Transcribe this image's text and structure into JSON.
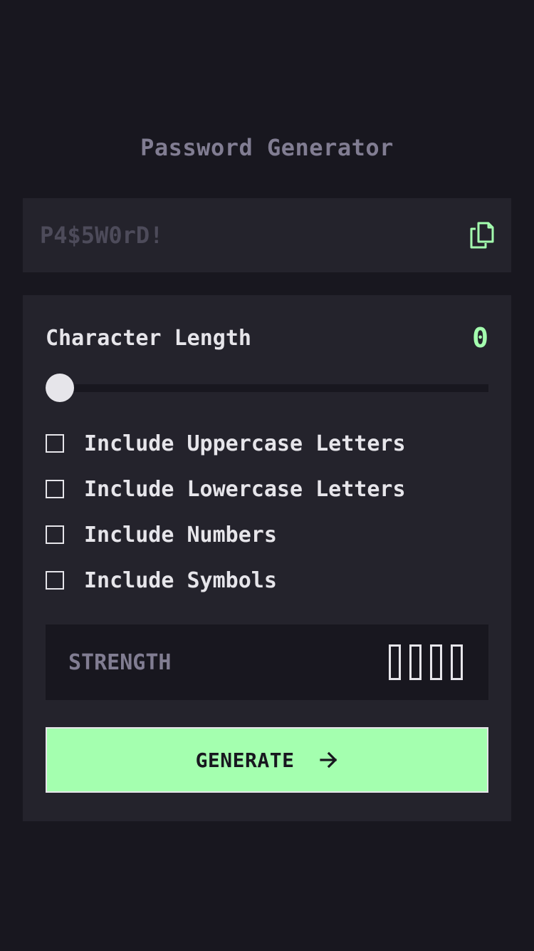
{
  "header": {
    "title": "Password Generator"
  },
  "output": {
    "password": "P4$5W0rD!",
    "copy_icon": "copy-icon"
  },
  "length": {
    "label": "Character Length",
    "value": "0",
    "slider_fraction": 0.0
  },
  "options": [
    {
      "label": "Include Uppercase Letters",
      "checked": false
    },
    {
      "label": "Include Lowercase Letters",
      "checked": false
    },
    {
      "label": "Include Numbers",
      "checked": false
    },
    {
      "label": "Include Symbols",
      "checked": false
    }
  ],
  "strength": {
    "label": "STRENGTH",
    "filled_bars": 0,
    "total_bars": 4
  },
  "generate": {
    "label": "GENERATE",
    "icon": "arrow-right-icon"
  },
  "colors": {
    "background": "#18171f",
    "panel": "#24232c",
    "accent": "#a4ffaf",
    "text": "#e6e5ea",
    "muted": "#817d92"
  }
}
